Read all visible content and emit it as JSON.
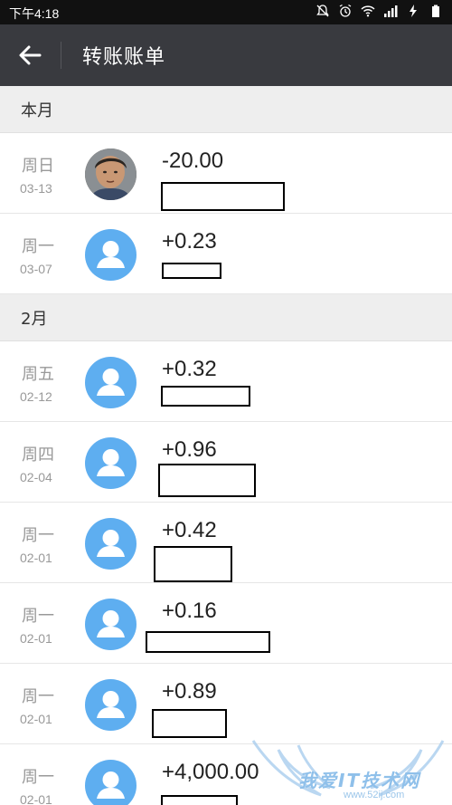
{
  "status_bar": {
    "time": "下午4:18"
  },
  "app_bar": {
    "title": "转账账单"
  },
  "sections": [
    {
      "header": "本月",
      "items": [
        {
          "day": "周日",
          "date": "03-13",
          "amount": "-20.00",
          "avatar": "photo"
        },
        {
          "day": "周一",
          "date": "03-07",
          "amount": "+0.23",
          "avatar": "default-person"
        }
      ]
    },
    {
      "header": "2月",
      "items": [
        {
          "day": "周五",
          "date": "02-12",
          "amount": "+0.32",
          "avatar": "default-person"
        },
        {
          "day": "周四",
          "date": "02-04",
          "amount": "+0.96",
          "avatar": "default-person"
        },
        {
          "day": "周一",
          "date": "02-01",
          "amount": "+0.42",
          "avatar": "default-person"
        },
        {
          "day": "周一",
          "date": "02-01",
          "amount": "+0.16",
          "avatar": "default-person"
        },
        {
          "day": "周一",
          "date": "02-01",
          "amount": "+0.89",
          "avatar": "default-person"
        },
        {
          "day": "周一",
          "date": "02-01",
          "amount": "+4,000.00",
          "avatar": "default-person"
        }
      ]
    }
  ],
  "watermark": {
    "text": "我爱IT技术网",
    "url": "www.52ij.com"
  },
  "colors": {
    "app_bar": "#393a3f",
    "avatar_blue": "#5eaef0",
    "section_bg": "#eeeeee"
  }
}
